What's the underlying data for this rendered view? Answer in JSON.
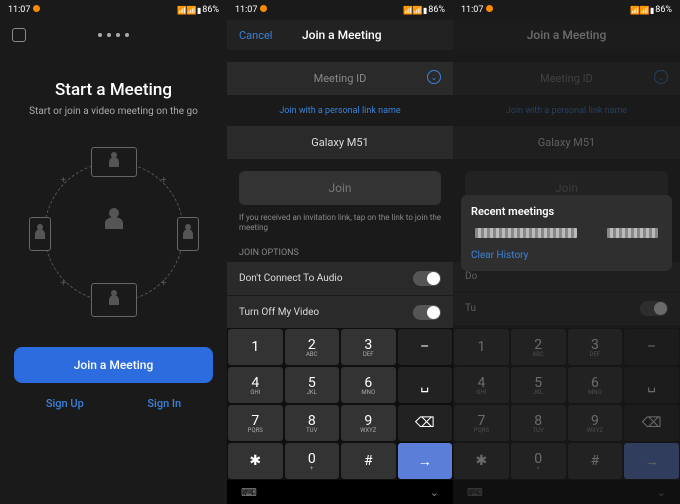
{
  "status": {
    "time": "11:07",
    "battery": "86%"
  },
  "screen1": {
    "title": "Start a Meeting",
    "subtitle": "Start or join a video meeting on the go",
    "join_btn": "Join a Meeting",
    "signup": "Sign Up",
    "signin": "Sign In"
  },
  "screen2": {
    "cancel": "Cancel",
    "title": "Join a Meeting",
    "meeting_id": "Meeting ID",
    "personal_link": "Join with a personal link name",
    "device_name": "Galaxy M51",
    "join": "Join",
    "hint": "If you received an invitation link, tap on the link to join the meeting",
    "options_label": "JOIN OPTIONS",
    "opt_audio": "Don't Connect To Audio",
    "opt_video": "Turn Off My Video"
  },
  "screen3": {
    "title": "Join a Meeting",
    "popup_title": "Recent meetings",
    "clear": "Clear History"
  },
  "keypad": {
    "r1": [
      {
        "n": "1",
        "s": ""
      },
      {
        "n": "2",
        "s": "ABC"
      },
      {
        "n": "3",
        "s": "DEF"
      },
      {
        "n": "–",
        "s": ""
      }
    ],
    "r2": [
      {
        "n": "4",
        "s": "GHI"
      },
      {
        "n": "5",
        "s": "JKL"
      },
      {
        "n": "6",
        "s": "MNO"
      },
      {
        "n": "␣",
        "s": ""
      }
    ],
    "r3": [
      {
        "n": "7",
        "s": "PQRS"
      },
      {
        "n": "8",
        "s": "TUV"
      },
      {
        "n": "9",
        "s": "WXYZ"
      },
      {
        "n": "⌫",
        "s": ""
      }
    ],
    "r4": [
      {
        "n": "✱",
        "s": ""
      },
      {
        "n": "0",
        "s": "+"
      },
      {
        "n": "#",
        "s": ""
      },
      {
        "n": "→",
        "s": ""
      }
    ]
  }
}
